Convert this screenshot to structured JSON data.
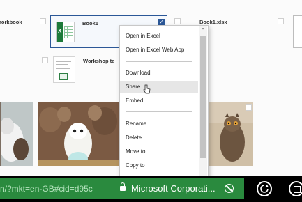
{
  "files": {
    "workbook_label": "rorkbook",
    "book1_label": "Book1",
    "book1xlsx_label": "Book1.xlsx",
    "workshop_label": "Workshop te"
  },
  "context_menu": {
    "items": [
      {
        "label": "Open in Excel"
      },
      {
        "label": "Open in Excel Web App"
      },
      {
        "label": "Download"
      },
      {
        "label": "Share"
      },
      {
        "label": "Embed"
      },
      {
        "label": "Rename"
      },
      {
        "label": "Delete"
      },
      {
        "label": "Move to"
      },
      {
        "label": "Copy to"
      }
    ],
    "hovered": "Share"
  },
  "address_bar": {
    "url_fragment": "n/?mkt=en-GB#cid=d95c",
    "site_identity": "Microsoft Corporati..."
  },
  "colors": {
    "selection": "#2b5797",
    "address_bar": "#2a8a3e",
    "taskbar": "#000000"
  },
  "icons": [
    "excel-file-icon",
    "document-icon",
    "checkbox-checked-icon",
    "lock-icon",
    "block-icon",
    "refresh-icon",
    "tabs-icon",
    "cursor-icon",
    "scroll-up-icon"
  ]
}
